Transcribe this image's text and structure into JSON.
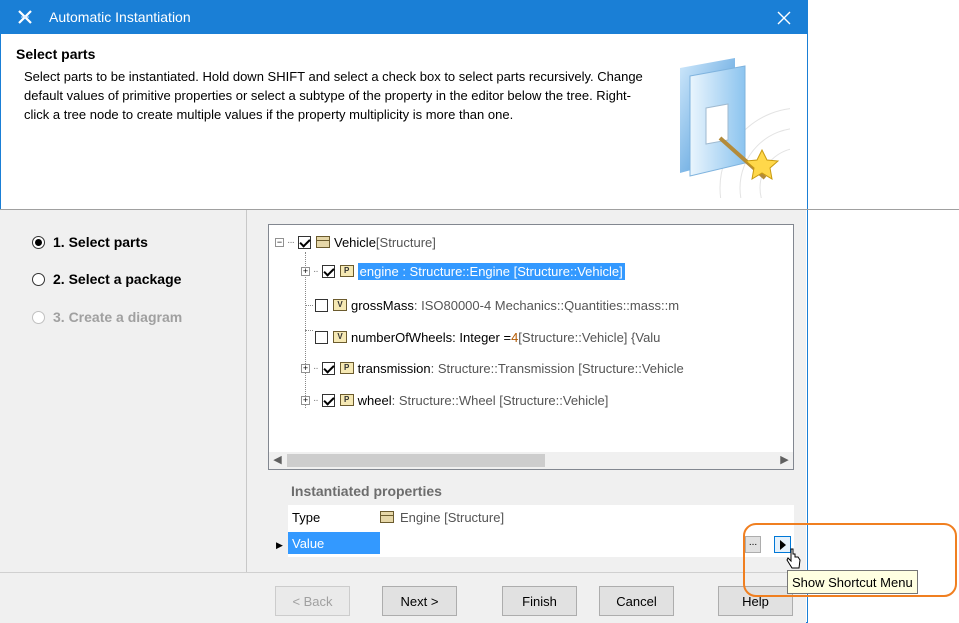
{
  "window": {
    "title": "Automatic Instantiation"
  },
  "header": {
    "title": "Select parts",
    "description": "Select parts to be instantiated. Hold down SHIFT and select a check box to select parts recursively. Change default values of primitive properties or select a subtype of the property in the editor below the tree. Right-click a tree node to create multiple values if the property multiplicity is more than one."
  },
  "steps": [
    {
      "label": "1. Select parts",
      "state": "selected"
    },
    {
      "label": "2. Select a package",
      "state": "enabled"
    },
    {
      "label": "3. Create a diagram",
      "state": "disabled"
    }
  ],
  "tree": {
    "root": {
      "name": "Vehicle",
      "suffix": " [Structure]",
      "checked": true,
      "icon": "block-icon"
    },
    "items": [
      {
        "name": "engine",
        "detail": " : Structure::Engine [Structure::Vehicle]",
        "checked": true,
        "icon": "part-icon",
        "icon_letter": "P",
        "expandable": true,
        "selected": true
      },
      {
        "name": "grossMass",
        "detail": " : ISO80000-4 Mechanics::Quantities::mass::m",
        "checked": false,
        "icon": "value-icon",
        "icon_letter": "V",
        "expandable": false
      },
      {
        "name": "numberOfWheels",
        "detail": " : Integer = ",
        "value": "4",
        "detail2": " [Structure::Vehicle] {Valu",
        "checked": false,
        "icon": "value-icon",
        "icon_letter": "V",
        "expandable": false
      },
      {
        "name": "transmission",
        "detail": " : Structure::Transmission [Structure::Vehicle",
        "checked": true,
        "icon": "part-icon",
        "icon_letter": "P",
        "expandable": true
      },
      {
        "name": "wheel",
        "detail": " : Structure::Wheel [Structure::Vehicle]",
        "checked": true,
        "icon": "part-icon",
        "icon_letter": "P",
        "expandable": true
      }
    ]
  },
  "properties": {
    "title": "Instantiated properties",
    "rows": [
      {
        "key": "Type",
        "value": "Engine [Structure]"
      },
      {
        "key": "Value",
        "value": ""
      }
    ],
    "ellipsis_label": "...",
    "tooltip": "Show Shortcut Menu"
  },
  "buttons": {
    "back": "< Back",
    "next": "Next >",
    "finish": "Finish",
    "cancel": "Cancel",
    "help": "Help"
  },
  "colors": {
    "titlebar": "#1a7fd6",
    "selection": "#3399ff",
    "highlight": "#f07f20",
    "tooltip_bg": "#ffffe1"
  }
}
